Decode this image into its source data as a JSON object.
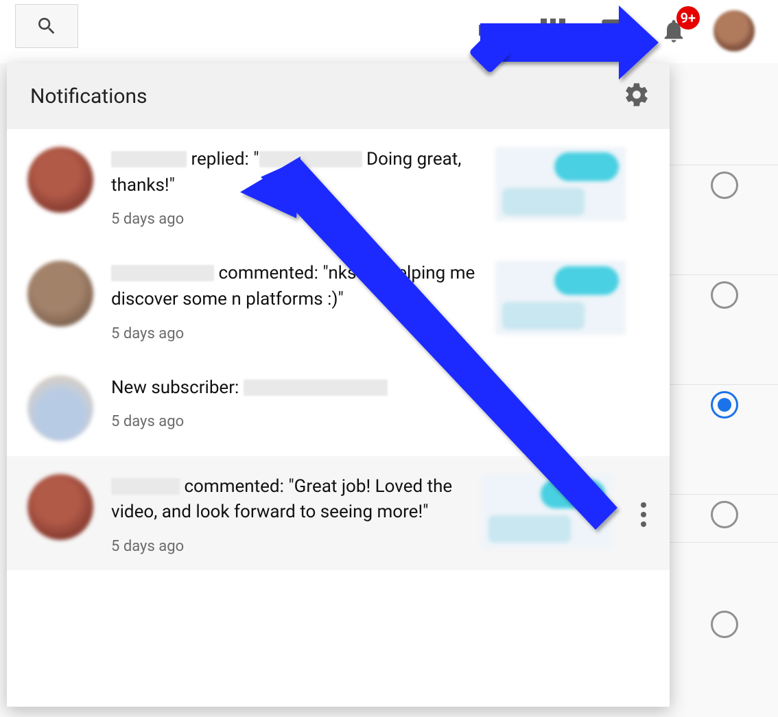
{
  "header": {
    "badge_text": "9+",
    "icons": {
      "search": "search-icon",
      "create": "create-video-icon",
      "apps": "apps-grid-icon",
      "messages": "messages-icon",
      "bell": "notifications-bell-icon"
    }
  },
  "panel": {
    "title": "Notifications"
  },
  "radios": [
    {
      "selected": false
    },
    {
      "selected": false
    },
    {
      "selected": true
    },
    {
      "selected": false
    },
    {
      "selected": false
    }
  ],
  "notifications": [
    {
      "text_pre": " replied: \"",
      "text_post": " Doing great, thanks!\"",
      "time": "5 days ago",
      "has_thumb": true,
      "avatar": "red"
    },
    {
      "text_pre": " commented: \"",
      "text_mid": "nks for helping me discover some n",
      "text_post": " platforms :)\"",
      "time": "5 days ago",
      "has_thumb": true,
      "avatar": "brown"
    },
    {
      "text_pre": "New subscriber: ",
      "time": "5 days ago",
      "has_thumb": false,
      "avatar": "blue"
    },
    {
      "text_pre": " commented: \"Great job! Loved the video, and look forward to seeing more!\"",
      "time": "5 days ago",
      "has_thumb": true,
      "avatar": "red",
      "hover": true
    }
  ]
}
